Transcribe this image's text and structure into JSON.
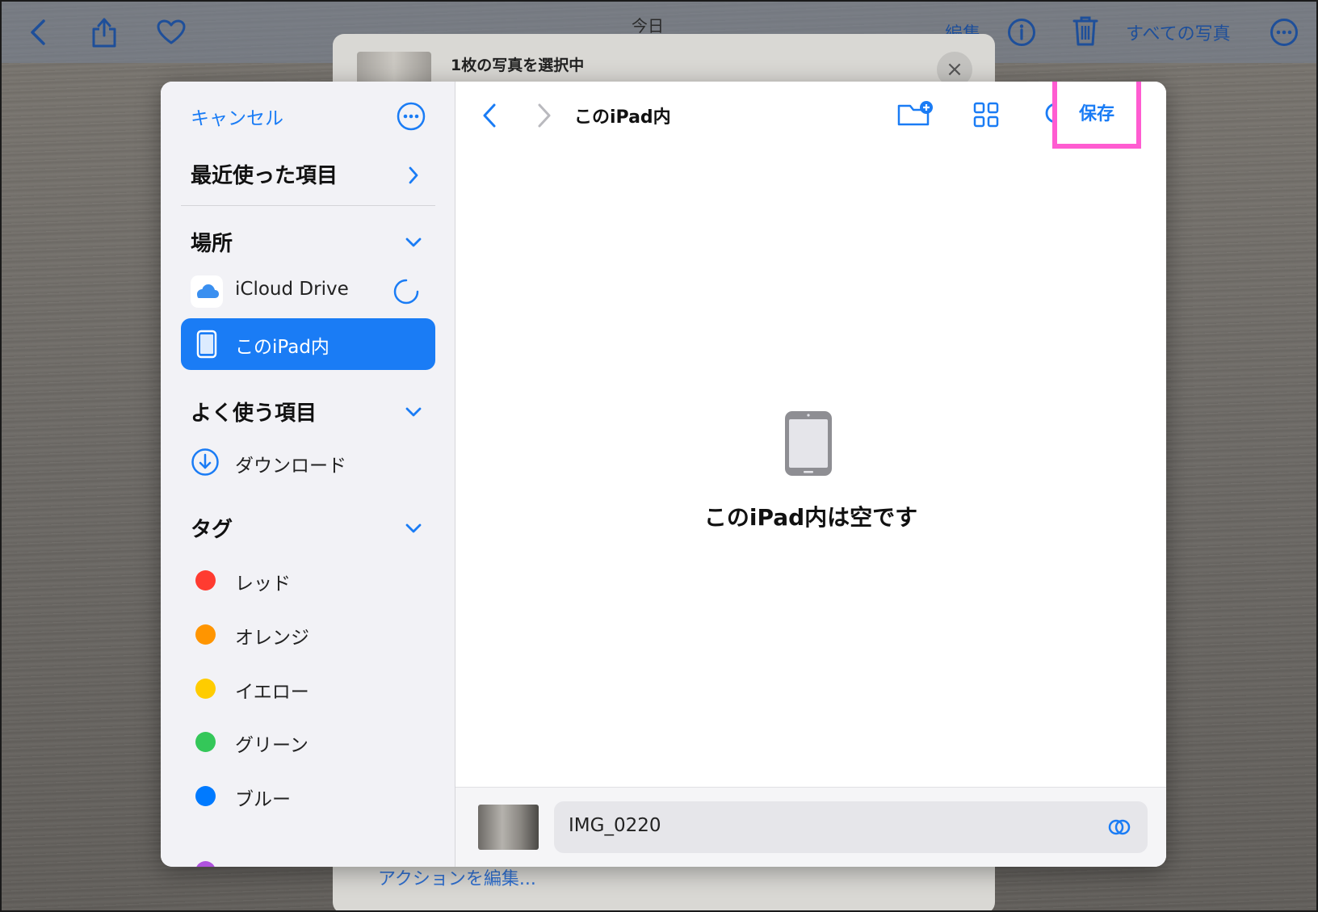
{
  "topbar": {
    "title": "今日",
    "edit_label": "編集",
    "all_photos_label": "すべての写真"
  },
  "back_sheet": {
    "title": "1枚の写真を選択中",
    "close_glyph": "×",
    "edit_actions_label": "アクションを編集..."
  },
  "sidebar": {
    "cancel_label": "キャンセル",
    "recents_label": "最近使った項目",
    "locations_heading": "場所",
    "locations": [
      {
        "label": "iCloud Drive"
      },
      {
        "label": "このiPad内"
      }
    ],
    "favorites_heading": "よく使う項目",
    "favorites": [
      {
        "label": "ダウンロード"
      }
    ],
    "tags_heading": "タグ",
    "tags": [
      {
        "label": "レッド",
        "color": "#ff3b30"
      },
      {
        "label": "オレンジ",
        "color": "#ff9500"
      },
      {
        "label": "イエロー",
        "color": "#ffcc00"
      },
      {
        "label": "グリーン",
        "color": "#34c759"
      },
      {
        "label": "ブルー",
        "color": "#007aff"
      }
    ]
  },
  "content": {
    "title": "このiPad内",
    "save_label": "保存",
    "empty_message": "このiPad内は空です"
  },
  "bottom": {
    "filename": "IMG_0220"
  },
  "colors": {
    "accent": "#1a7cf5",
    "highlight_box": "#ff5cd1"
  }
}
